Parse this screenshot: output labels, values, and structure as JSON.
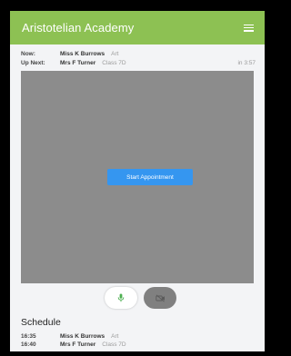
{
  "header": {
    "title": "Aristotelian Academy",
    "menu_icon": "hamburger-menu-icon",
    "color": "#8dc153"
  },
  "status": {
    "now_label": "Now:",
    "now_name": "Miss K Burrows",
    "now_subject": "Art",
    "next_label": "Up Next:",
    "next_name": "Mrs F Turner",
    "next_class": "Class 7D",
    "next_eta": "in 3:57"
  },
  "video": {
    "start_label": "Start Appointment",
    "background": "#8c8c8c",
    "button_color": "#3596f0"
  },
  "controls": {
    "mic_icon": "microphone-icon",
    "camera_icon": "camera-off-icon",
    "mic_color": "#4caf50"
  },
  "schedule": {
    "heading": "Schedule",
    "items": [
      {
        "time": "16:35",
        "name": "Miss K Burrows",
        "detail": "Art"
      },
      {
        "time": "16:40",
        "name": "Mrs F Turner",
        "detail": "Class 7D"
      }
    ]
  }
}
